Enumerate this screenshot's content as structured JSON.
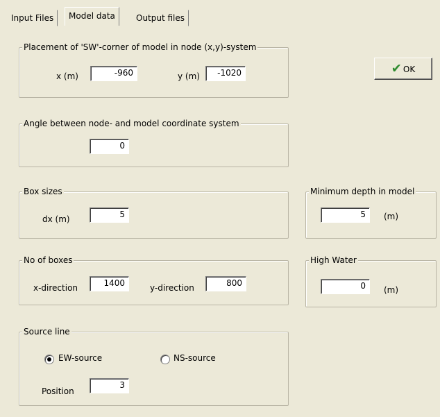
{
  "tabs": [
    {
      "label": "Input Files"
    },
    {
      "label": "Model data"
    },
    {
      "label": "Output files"
    }
  ],
  "ok_button": {
    "label": "OK",
    "icon": "checkmark-icon"
  },
  "placement": {
    "title": "Placement of 'SW'-corner of model in node (x,y)-system",
    "x_label": "x (m)",
    "x_value": "-960",
    "y_label": "y (m)",
    "y_value": "-1020"
  },
  "angle": {
    "title": "Angle between node- and model coordinate system",
    "value": "0"
  },
  "box_sizes": {
    "title": "Box sizes",
    "dx_label": "dx (m)",
    "dx_value": "5"
  },
  "min_depth": {
    "title": "Minimum depth in model",
    "value": "5",
    "unit": "(m)"
  },
  "no_of_boxes": {
    "title": "No of boxes",
    "x_label": "x-direction",
    "x_value": "1400",
    "y_label": "y-direction",
    "y_value": "800"
  },
  "high_water": {
    "title": "High Water",
    "value": "0",
    "unit": "(m)"
  },
  "source_line": {
    "title": "Source line",
    "ew_label": "EW-source",
    "ns_label": "NS-source",
    "selected": "EW-source",
    "position_label": "Position",
    "position_value": "3"
  }
}
